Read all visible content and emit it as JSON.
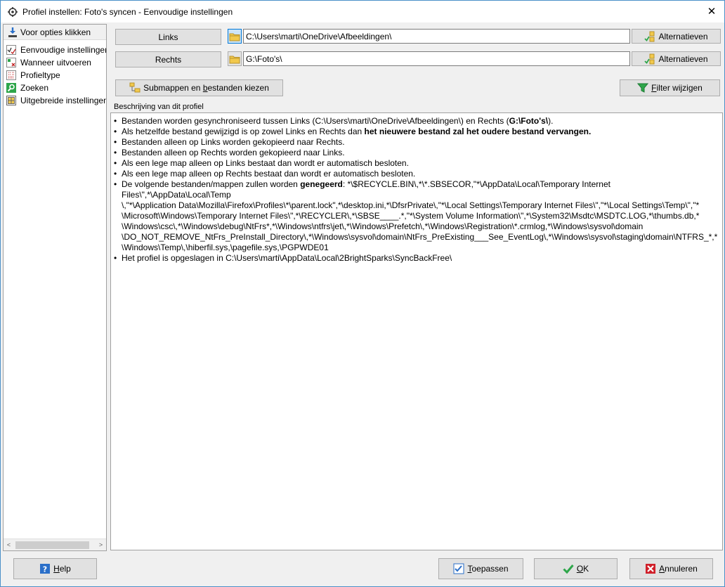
{
  "window": {
    "title": "Profiel instellen: Foto's syncen - Eenvoudige instellingen",
    "close_glyph": "✕"
  },
  "left_panel": {
    "header": "Voor opties klikken",
    "items": [
      {
        "label": "Eenvoudige instellingen",
        "icon": "checklist-icon"
      },
      {
        "label": "Wanneer uitvoeren",
        "icon": "schedule-icon"
      },
      {
        "label": "Profieltype",
        "icon": "profile-type-icon"
      },
      {
        "label": "Zoeken",
        "icon": "search-icon"
      },
      {
        "label": "Uitgebreide instellingen",
        "icon": "grid-icon"
      }
    ],
    "scroll_left": "<",
    "scroll_right": ">"
  },
  "paths": {
    "left_label": "Links",
    "left_value": "C:\\Users\\marti\\OneDrive\\Afbeeldingen\\",
    "right_label": "Rechts",
    "right_value": "G:\\Foto's\\",
    "alternatives_label": "Alternatieven"
  },
  "actions": {
    "subfolders_prefix": "Submappen en ",
    "subfolders_accel": "b",
    "subfolders_suffix": "estanden kiezen",
    "filter_accel": "F",
    "filter_suffix": "ilter wijzigen"
  },
  "description": {
    "label": "Beschrijving van dit profiel",
    "lines": {
      "l1_a": "Bestanden worden gesynchroniseerd tussen Links (C:\\Users\\marti\\OneDrive\\Afbeeldingen\\) en Rechts (",
      "l1_b": "G:\\Foto's\\",
      "l1_c": ").",
      "l2_a": "Als hetzelfde bestand gewijzigd is op zowel Links en Rechts dan ",
      "l2_b": "het nieuwere bestand zal het oudere bestand vervangen.",
      "l3": "Bestanden alleen op Links worden gekopieerd naar Rechts.",
      "l4": "Bestanden alleen op Rechts worden gekopieerd naar Links.",
      "l5": "Als een lege map alleen op Links bestaat dan wordt er automatisch besloten.",
      "l6": "Als een lege map alleen op Rechts bestaat dan wordt er automatisch besloten.",
      "l7_a": "De volgende bestanden/mappen zullen worden ",
      "l7_b": "genegeerd",
      "l7_c": ": *\\$RECYCLE.BIN\\,*\\*.SBSECOR,\"*\\AppData\\Local\\Temporary Internet Files\\\",*\\AppData\\Local\\Temp",
      "l7_d": "\\,\"*\\Application Data\\Mozilla\\Firefox\\Profiles\\*\\parent.lock\",*\\desktop.ini,*\\DfsrPrivate\\,\"*\\Local Settings\\Temporary Internet Files\\\",\"*\\Local Settings\\Temp\\\",\"*",
      "l7_e": "\\Microsoft\\Windows\\Temporary Internet Files\\\",*\\RECYCLER\\,*\\SBSE____.*,\"*\\System Volume Information\\\",*\\System32\\Msdtc\\MSDTC.LOG,*\\thumbs.db,*",
      "l7_f": "\\Windows\\csc\\,*\\Windows\\debug\\NtFrs*,*\\Windows\\ntfrs\\jet\\,*\\Windows\\Prefetch\\,*\\Windows\\Registration\\*.crmlog,*\\Windows\\sysvol\\domain",
      "l7_g": "\\DO_NOT_REMOVE_NtFrs_PreInstall_Directory\\,*\\Windows\\sysvol\\domain\\NtFrs_PreExisting___See_EventLog\\,*\\Windows\\sysvol\\staging\\domain\\NTFRS_*,*",
      "l7_h": "\\Windows\\Temp\\,\\hiberfil.sys,\\pagefile.sys,\\PGPWDE01",
      "l8": "Het profiel is opgeslagen in C:\\Users\\marti\\AppData\\Local\\2BrightSparks\\SyncBackFree\\"
    }
  },
  "footer": {
    "help_accel": "H",
    "help_suffix": "elp",
    "apply_accel": "T",
    "apply_suffix": "oepassen",
    "ok_accel": "O",
    "ok_suffix": "K",
    "cancel_accel": "A",
    "cancel_suffix": "nnuleren"
  },
  "colors": {
    "accent": "#0078d7",
    "window_border": "#4a90c8",
    "ok_green": "#2ea64a",
    "cancel_red": "#d0202a",
    "help_blue": "#2a6fc9",
    "folder_yellow": "#f2c94c"
  }
}
